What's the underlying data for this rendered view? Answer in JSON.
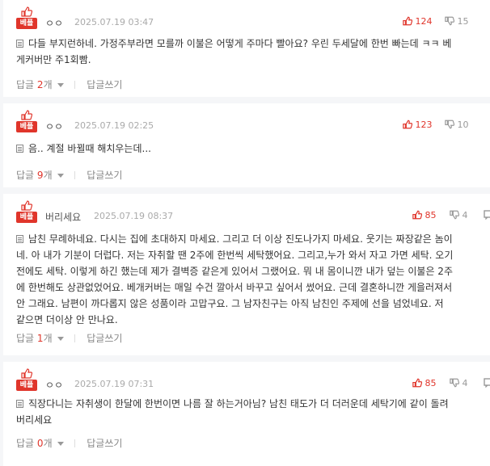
{
  "badge_label": "베플",
  "reply_label": "답글",
  "write_reply_label": "답글쓰기",
  "count_suffix": "개",
  "comments": [
    {
      "nick": "ㅇㅇ",
      "date": "2025.07.19 03:47",
      "up": "124",
      "down": "15",
      "lines": [
        "다들 부지런하네. 가정주부라면 모를까 이불은 어떻게 주마다 빨아요? 우린 두세달에 한번 빠는데 ㅋㅋ 베",
        "게커버만 주1회빰."
      ],
      "reply_count": "2"
    },
    {
      "nick": "ㅇㅇ",
      "date": "2025.07.19 02:25",
      "up": "123",
      "down": "10",
      "lines": [
        "음.. 계절 바뀔때 해치우는데..."
      ],
      "reply_count": "9"
    },
    {
      "nick": "버리세요",
      "date": "2025.07.19 08:37",
      "up": "85",
      "down": "4",
      "lines": [
        "남친 무례하네요. 다시는 집에 초대하지 마세요. 그리고 더 이상 진도나가지 마세요. 웃기는 짜장같은 놈이",
        "네. 아 내가 기분이 더럽다. 저는 자취할 땐 2주에 한번씩 세탁했어요. 그리고,누가 와서 자고 가면 세탁. 오기",
        "전에도 세탁. 이렇게 하긴 했는데 제가 결벽증 같은게 있어서 그랬어요. 뭐 내 몸이니깐 내가 덮는 이불은 2주",
        "에 한번해도 상관없었어요. 베개커버는 매일 수건 깔아서 바꾸고 싶어서 썼어요. 근데 결혼하니깐 게을러져서",
        "안 그래요. 남편이 까다롭지 않은 성품이라 고맙구요. 그 남자친구는 아직 남친인 주제에 선을 넘었네요. 저",
        "같으면 더이상 안 만나요."
      ],
      "reply_count": "1"
    },
    {
      "nick": "ㅇㅇ",
      "date": "2025.07.19 07:31",
      "up": "85",
      "down": "4",
      "lines": [
        "직장다니는 자취생이 한달에 한번이면 나름 잘 하는거아님? 남친 태도가 더 더러운데 세탁기에 같이 돌려",
        "버리세요"
      ],
      "reply_count": "0"
    }
  ]
}
